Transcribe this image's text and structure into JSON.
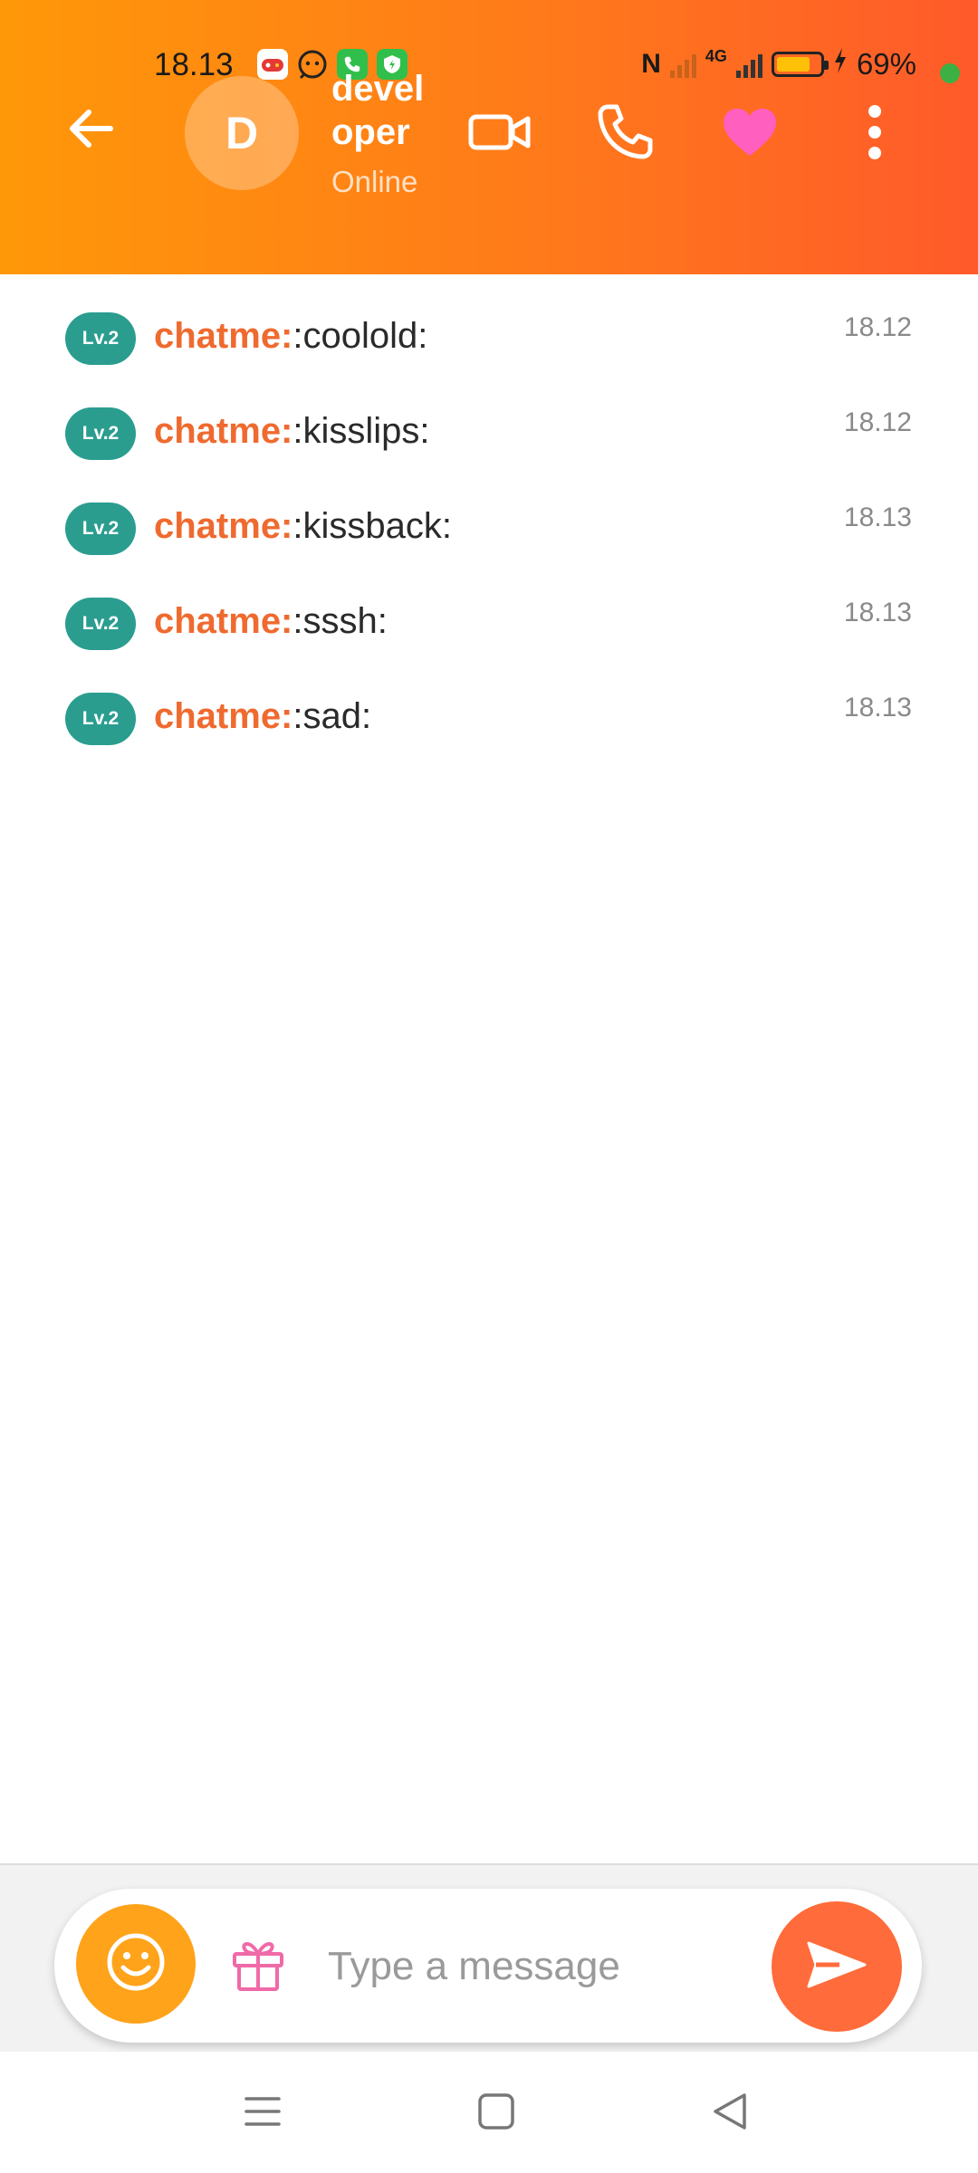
{
  "status_bar": {
    "time": "18.13",
    "battery_text": "69%",
    "battery_level": 0.69,
    "network": "4G",
    "notification_icons": [
      "game-icon",
      "chat-bot-icon",
      "phone-app-icon",
      "shield-app-icon"
    ]
  },
  "header": {
    "avatar_initial": "D",
    "contact_name": "developer",
    "contact_status": "Online",
    "icons": [
      "back-arrow-icon",
      "video-call-icon",
      "voice-call-icon",
      "heart-icon",
      "more-vert-icon"
    ]
  },
  "messages": [
    {
      "level": "Lv.2",
      "sender": "chatme:",
      "text": ":coolold:",
      "time": "18.12"
    },
    {
      "level": "Lv.2",
      "sender": "chatme:",
      "text": ":kisslips:",
      "time": "18.12"
    },
    {
      "level": "Lv.2",
      "sender": "chatme:",
      "text": ":kissback:",
      "time": "18.13"
    },
    {
      "level": "Lv.2",
      "sender": "chatme:",
      "text": ":sssh:",
      "time": "18.13"
    },
    {
      "level": "Lv.2",
      "sender": "chatme:",
      "text": ":sad:",
      "time": "18.13"
    }
  ],
  "composer": {
    "placeholder": "Type a message",
    "value": "",
    "icons": [
      "emoji-icon",
      "gift-icon",
      "send-icon"
    ]
  },
  "nav": {
    "icons": [
      "menu-icon",
      "home-icon",
      "back-icon"
    ]
  },
  "colors": {
    "header_gradient_start": "#ff9809",
    "header_gradient_end": "#ff5a2a",
    "sender": "#ef6a2f",
    "level_badge": "#2a9d8f",
    "emoji_button": "#ffa31a",
    "send_button": "#ff6b3a",
    "heart": "#ff5fbf",
    "gift": "#f06aa8"
  }
}
